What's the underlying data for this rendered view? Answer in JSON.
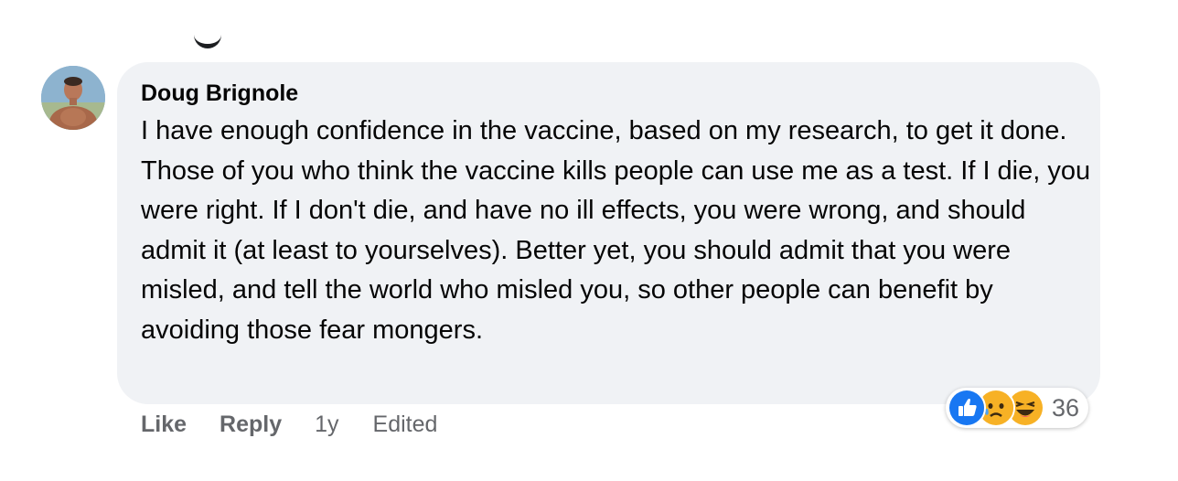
{
  "comment": {
    "author": "Doug Brignole",
    "text": "I have enough confidence in the vaccine, based on my research, to get it done. Those of you who think the vaccine kills people can use me as a test. If I die, you were right. If I don't die, and have no ill effects, you were wrong, and should admit it (at least to yourselves). Better yet, you should admit that you were misled, and tell the world who misled you, so other people can benefit by avoiding those fear mongers.",
    "avatar_icon": "profile-photo",
    "bubble_color": "#f0f2f5"
  },
  "actions": {
    "like_label": "Like",
    "reply_label": "Reply",
    "timestamp": "1y",
    "edited_label": "Edited"
  },
  "reactions": {
    "icons": [
      "like-reaction-icon",
      "sad-reaction-icon",
      "haha-reaction-icon"
    ],
    "count": "36",
    "like_color": "#1877f2",
    "emoji_color": "#f7b125"
  }
}
